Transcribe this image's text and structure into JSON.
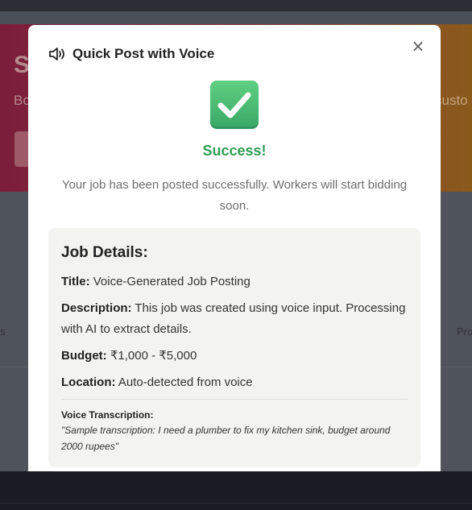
{
  "background": {
    "hero_title": "S",
    "hero_sub_left": "Bo",
    "hero_sub_right": "custo",
    "row_text_left": "s",
    "row_text_right": "Pro"
  },
  "modal": {
    "icon": "speaker-icon",
    "title": "Quick Post with Voice",
    "close_label": "×",
    "success_icon": "check-mark-icon",
    "success_title": "Success!",
    "success_message": "Your job has been posted successfully. Workers will start bidding soon.",
    "details": {
      "heading": "Job Details:",
      "title_label": "Title:",
      "title_value": "Voice-Generated Job Posting",
      "description_label": "Description:",
      "description_value": "This job was created using voice input. Processing with AI to extract details.",
      "budget_label": "Budget:",
      "budget_value": "₹1,000 - ₹5,000",
      "location_label": "Location:",
      "location_value": "Auto-detected from voice",
      "transcription_label": "Voice Transcription:",
      "transcription_value": "\"Sample transcription: I need a plumber to fix my kitchen sink, budget around 2000 rupees\""
    }
  },
  "colors": {
    "success": "#2f9e55",
    "success_icon_bg": "#4cbf73",
    "details_bg": "#f3f3f2"
  }
}
